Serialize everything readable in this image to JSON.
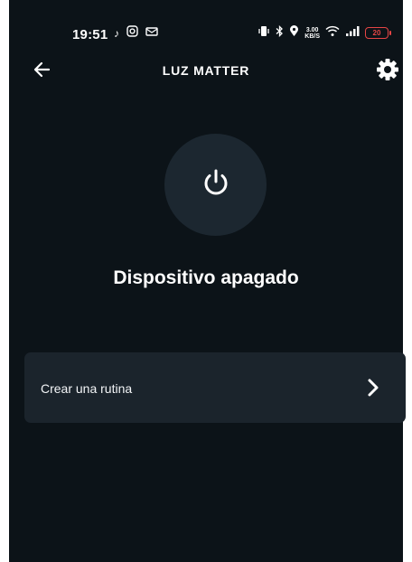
{
  "status_bar": {
    "time": "19:51",
    "net_speed_value": "3.00",
    "net_speed_unit": "KB/S",
    "battery": "20"
  },
  "header": {
    "title": "LUZ MATTER",
    "back_icon": "arrow-left-icon",
    "settings_icon": "gear-icon"
  },
  "device": {
    "power_icon": "power-icon",
    "status": "Dispositivo apagado"
  },
  "actions": [
    {
      "label": "Crear una rutina",
      "icon": "chevron-right-icon"
    }
  ],
  "colors": {
    "background": "#0c1318",
    "surface": "#1b242c",
    "power_circle": "#1c2730",
    "text": "#ffffff",
    "battery_low": "#e64545"
  }
}
